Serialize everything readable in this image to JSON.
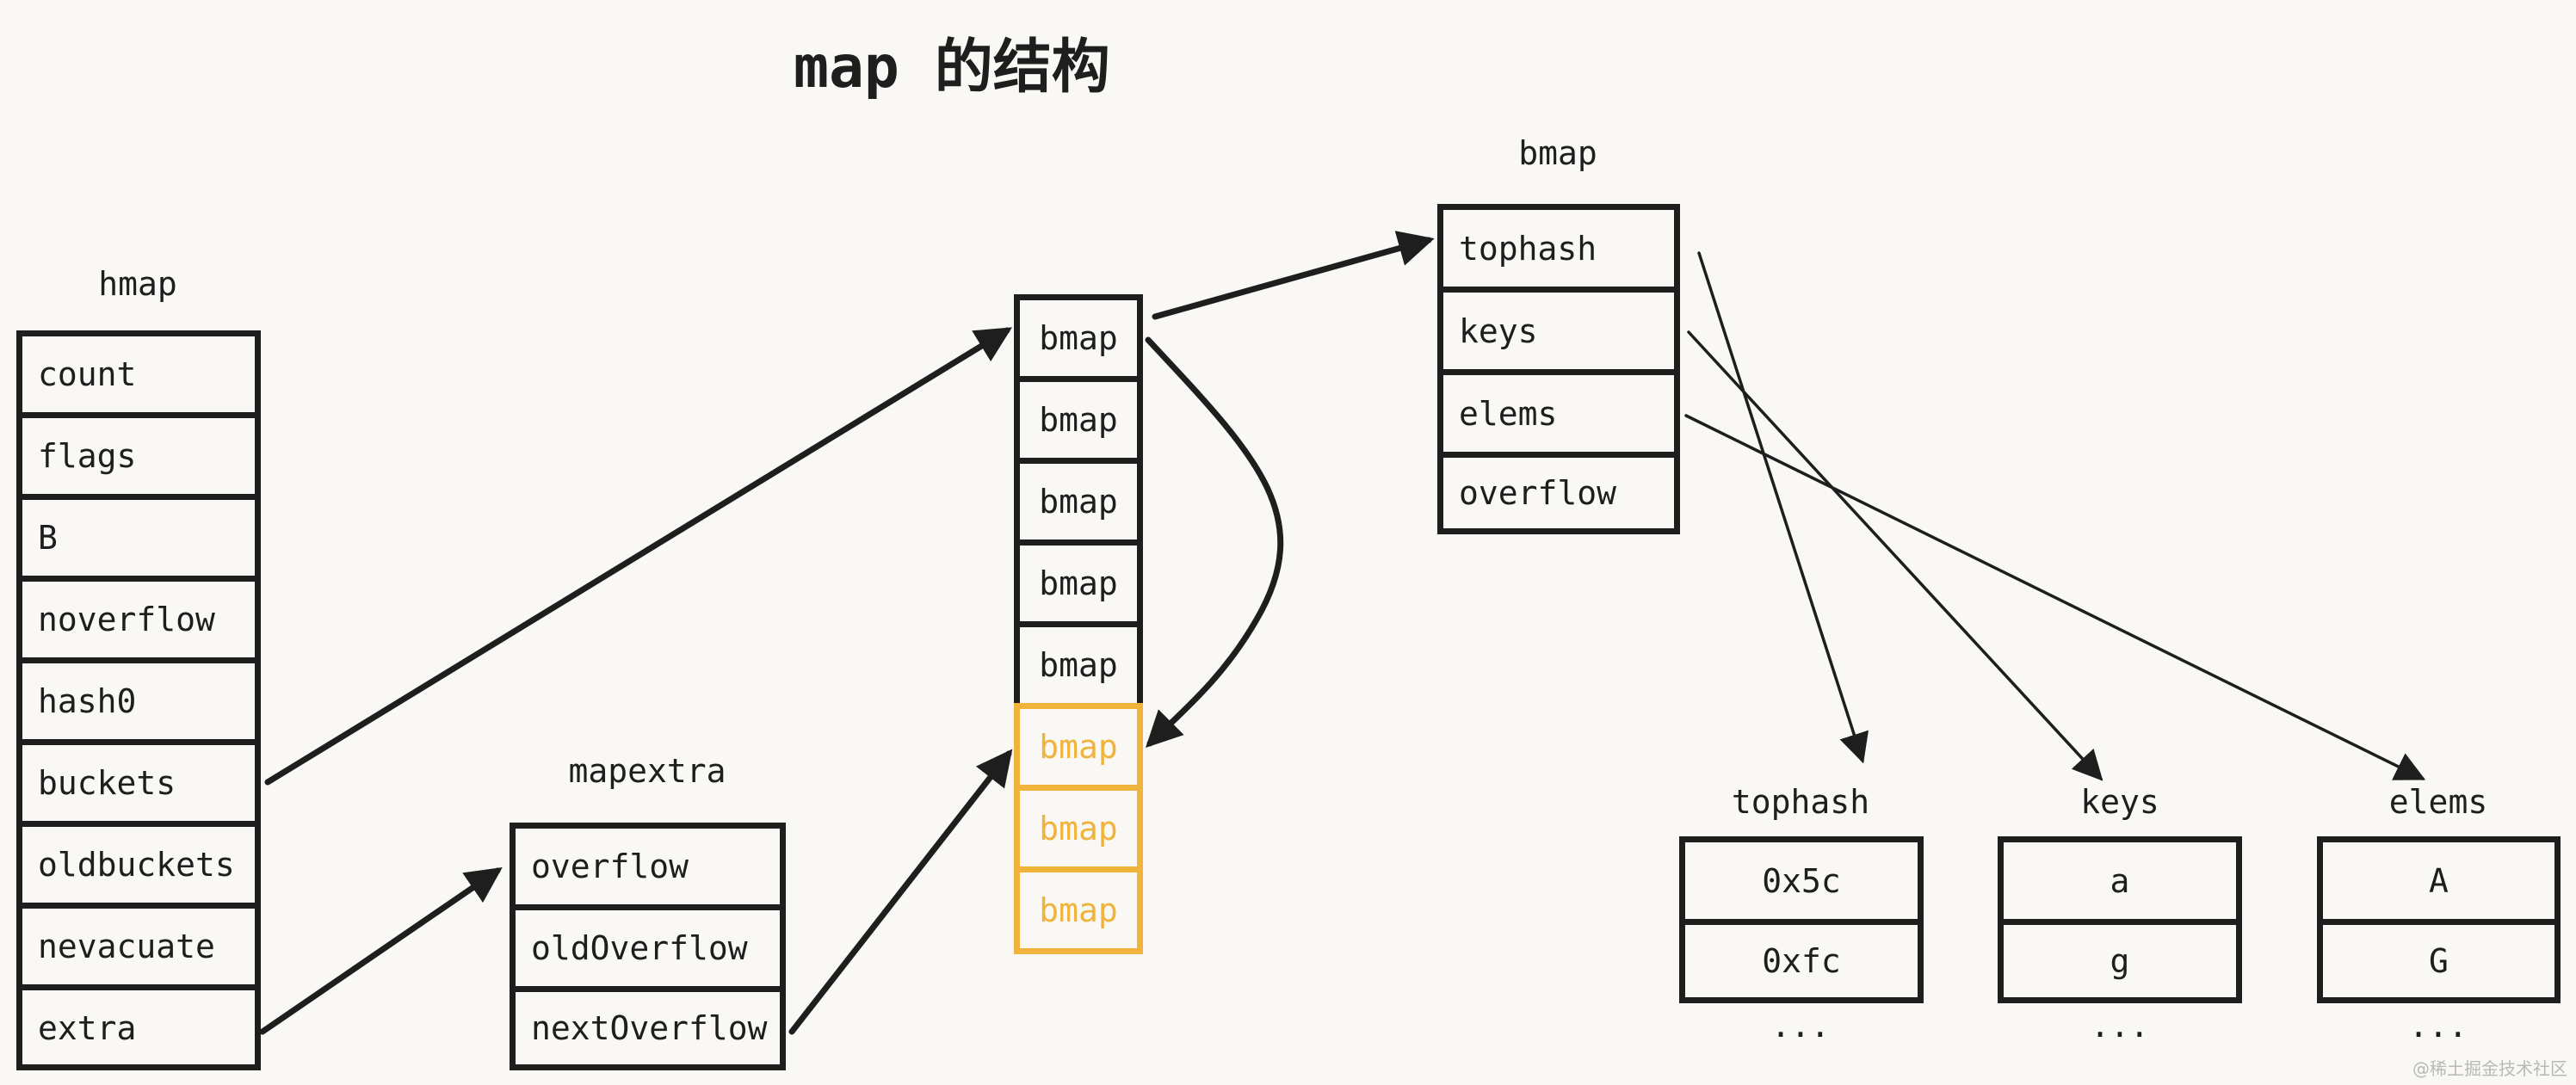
{
  "title": "map 的结构",
  "hmap": {
    "label": "hmap",
    "fields": [
      "count",
      "flags",
      "B",
      "noverflow",
      "hash0",
      "buckets",
      "oldbuckets",
      "nevacuate",
      "extra"
    ]
  },
  "mapextra": {
    "label": "mapextra",
    "fields": [
      "overflow",
      "oldOverflow",
      "nextOverflow"
    ]
  },
  "buckets": {
    "cells": [
      {
        "label": "bmap",
        "highlight": false
      },
      {
        "label": "bmap",
        "highlight": false
      },
      {
        "label": "bmap",
        "highlight": false
      },
      {
        "label": "bmap",
        "highlight": false
      },
      {
        "label": "bmap",
        "highlight": false
      },
      {
        "label": "bmap",
        "highlight": true
      },
      {
        "label": "bmap",
        "highlight": true
      },
      {
        "label": "bmap",
        "highlight": true
      }
    ],
    "highlight_color": "#f0b43c"
  },
  "bmap": {
    "label": "bmap",
    "fields": [
      "tophash",
      "keys",
      "elems",
      "overflow"
    ]
  },
  "arrays": [
    {
      "label": "tophash",
      "values": [
        "0x5c",
        "0xfc"
      ],
      "more": "..."
    },
    {
      "label": "keys",
      "values": [
        "a",
        "g"
      ],
      "more": "..."
    },
    {
      "label": "elems",
      "values": [
        "A",
        "G"
      ],
      "more": "..."
    }
  ],
  "arrows": [
    {
      "from": "hmap.buckets",
      "to": "buckets[0]"
    },
    {
      "from": "hmap.extra",
      "to": "mapextra"
    },
    {
      "from": "mapextra.nextOverflow",
      "to": "buckets[5]"
    },
    {
      "from": "buckets[0]",
      "to": "bmap"
    },
    {
      "from": "buckets[0].overflow",
      "to": "buckets[5]"
    },
    {
      "from": "bmap.tophash",
      "to": "tophash-array"
    },
    {
      "from": "bmap.keys",
      "to": "keys-array"
    },
    {
      "from": "bmap.elems",
      "to": "elems-array"
    }
  ],
  "watermark": "@稀土掘金技术社区"
}
